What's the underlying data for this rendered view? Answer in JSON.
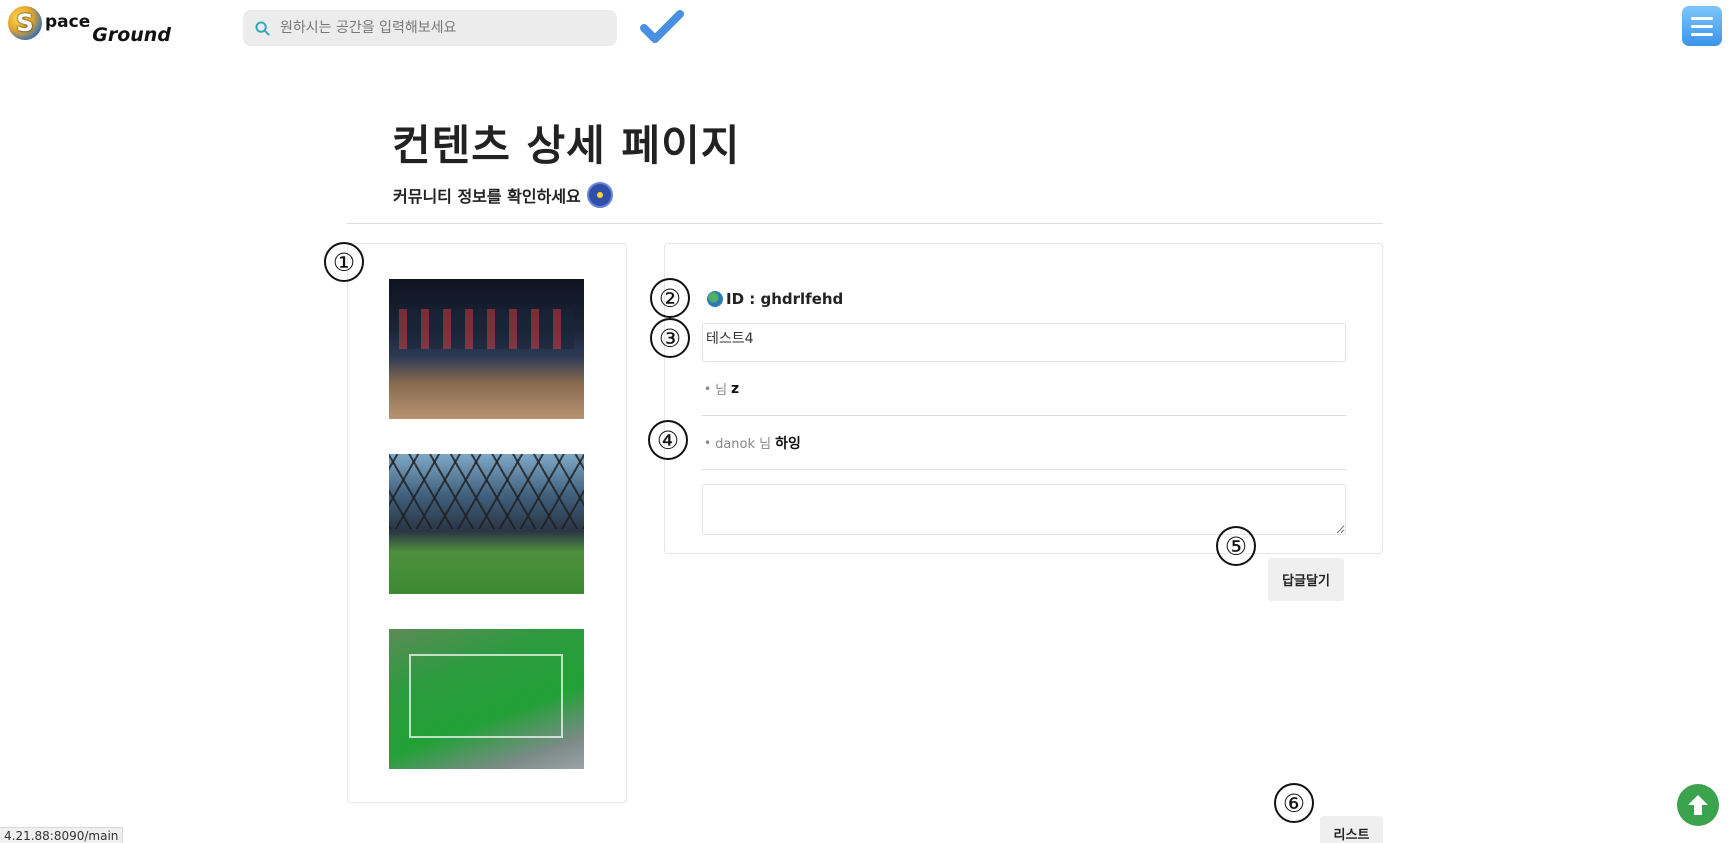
{
  "header": {
    "logo_letter": "S",
    "logo_word1": "pace",
    "logo_word2": "Ground",
    "search_placeholder": "원하시는 공간을 입력해보세요",
    "menu_icon": "hamburger-menu-icon",
    "check_icon": "checkmark-icon",
    "accent_color": "#3b94e8"
  },
  "page": {
    "title": "컨텐츠 상세 페이지",
    "subtitle": "커뮤니티 정보를 확인하세요"
  },
  "post": {
    "author": "ID : ghdrlfehd",
    "content": "테스트4",
    "replies": [
      {
        "bullet": "•",
        "user": "님",
        "text": "z"
      },
      {
        "bullet": "•",
        "user": "danok 님",
        "text": "하잉"
      }
    ],
    "reply_input_value": ""
  },
  "buttons": {
    "reply": "답글달기",
    "list": "리스트"
  },
  "markers": [
    "①",
    "②",
    "③",
    "④",
    "⑤",
    "⑥"
  ],
  "status_url": "4.21.88:8090/main"
}
